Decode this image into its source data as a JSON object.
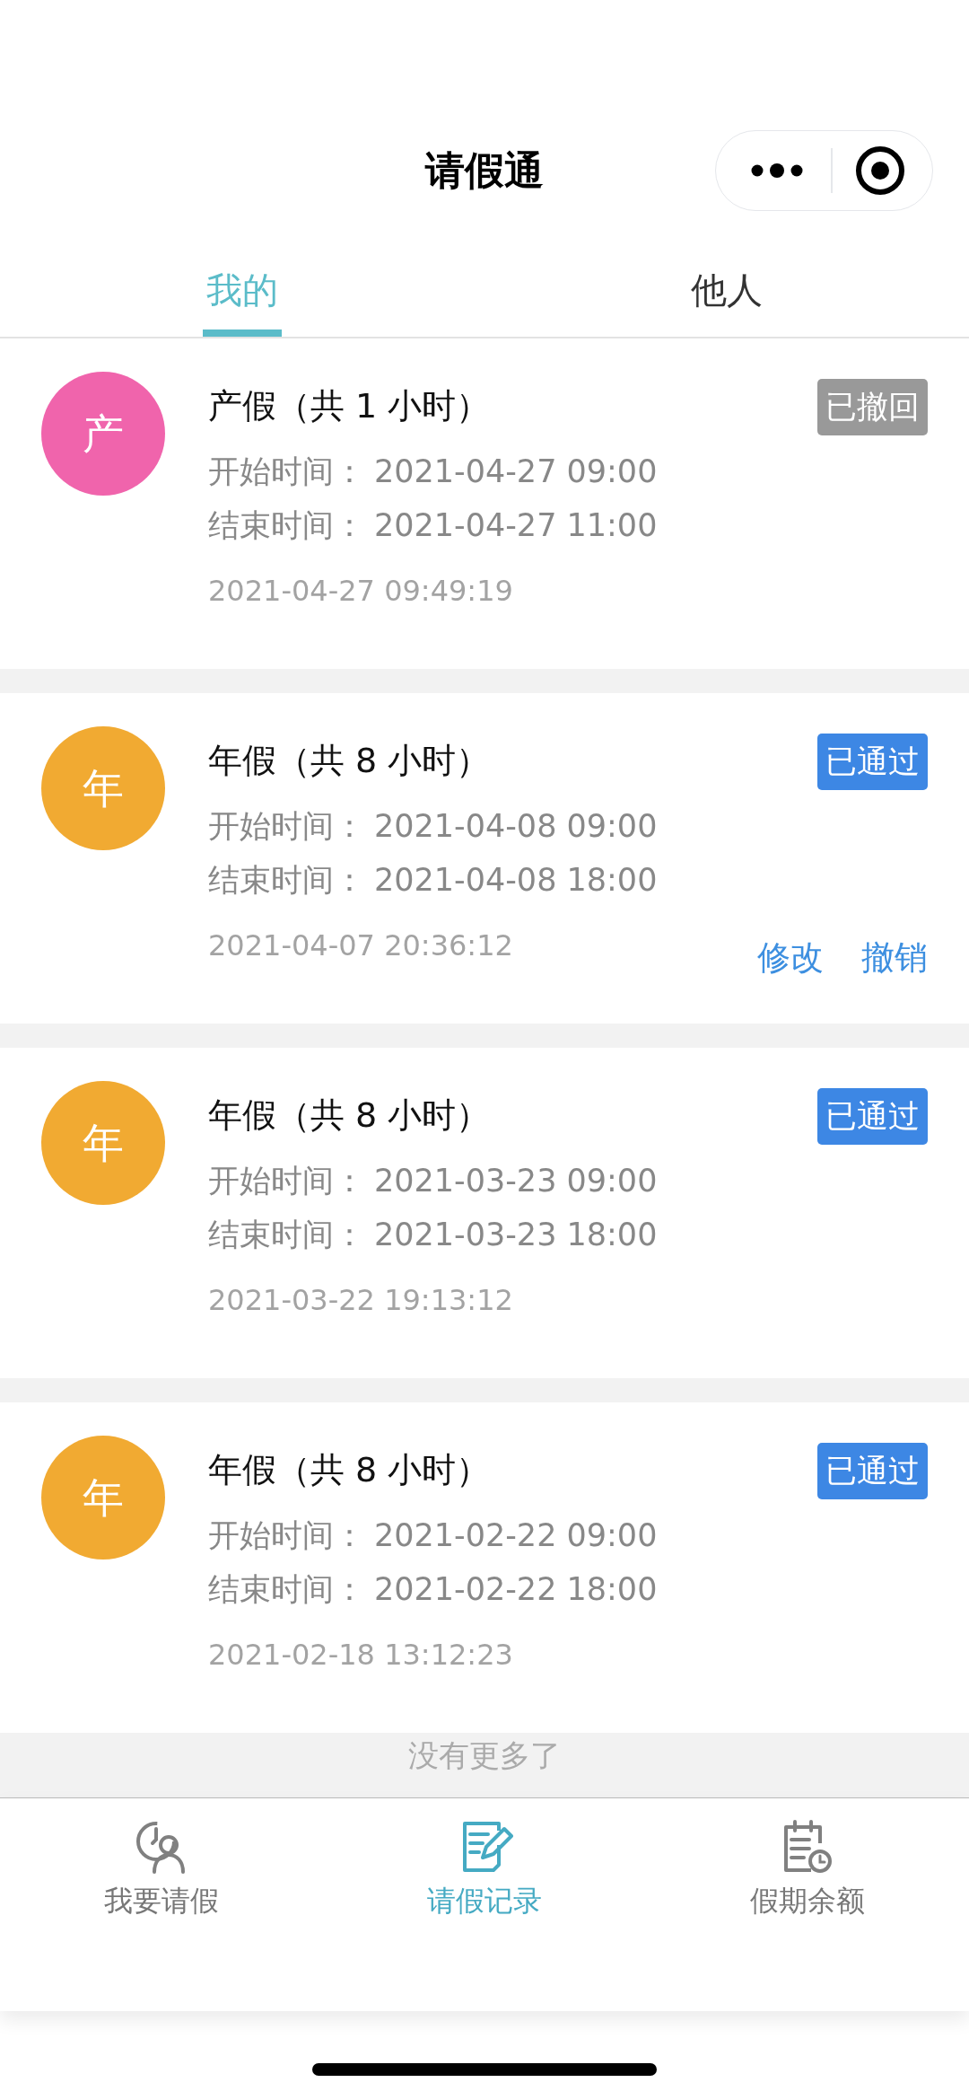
{
  "header": {
    "title": "请假通"
  },
  "tabs": [
    {
      "label": "我的",
      "selected": true
    },
    {
      "label": "他人",
      "selected": false
    }
  ],
  "records": [
    {
      "avatar": {
        "text": "产",
        "color": "#f064ac"
      },
      "title": "产假（共 1 小时）",
      "status": {
        "text": "已撤回",
        "color": "#999999"
      },
      "start_label": "开始时间：",
      "start": "2021-04-27 09:00",
      "end_label": "结束时间：",
      "end": "2021-04-27 11:00",
      "submitted": "2021-04-27 09:49:19"
    },
    {
      "avatar": {
        "text": "年",
        "color": "#f1aa32"
      },
      "title": "年假（共 8 小时）",
      "status": {
        "text": "已通过",
        "color": "#3d87e4"
      },
      "start_label": "开始时间：",
      "start": "2021-04-08 09:00",
      "end_label": "结束时间：",
      "end": "2021-04-08 18:00",
      "submitted": "2021-04-07 20:36:12",
      "actions": [
        "修改",
        "撤销"
      ]
    },
    {
      "avatar": {
        "text": "年",
        "color": "#f1aa32"
      },
      "title": "年假（共 8 小时）",
      "status": {
        "text": "已通过",
        "color": "#3d87e4"
      },
      "start_label": "开始时间：",
      "start": "2021-03-23 09:00",
      "end_label": "结束时间：",
      "end": "2021-03-23 18:00",
      "submitted": "2021-03-22 19:13:12"
    },
    {
      "avatar": {
        "text": "年",
        "color": "#f1aa32"
      },
      "title": "年假（共 8 小时）",
      "status": {
        "text": "已通过",
        "color": "#3d87e4"
      },
      "start_label": "开始时间：",
      "start": "2021-02-22 09:00",
      "end_label": "结束时间：",
      "end": "2021-02-22 18:00",
      "submitted": "2021-02-18 13:12:23"
    }
  ],
  "end_note": "没有更多了",
  "bottom_nav": [
    {
      "label": "我要请假",
      "kind": "person",
      "selected": false
    },
    {
      "label": "请假记录",
      "kind": "edit",
      "selected": true
    },
    {
      "label": "假期余额",
      "kind": "calendar",
      "selected": false
    }
  ]
}
